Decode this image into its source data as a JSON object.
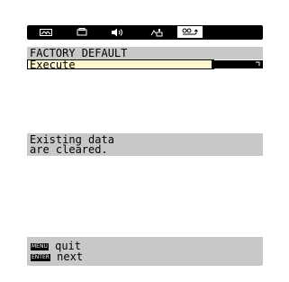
{
  "tabs": [
    {
      "icon": "picture-icon"
    },
    {
      "icon": "display-icon"
    },
    {
      "icon": "audio-icon"
    },
    {
      "icon": "settings-icon"
    },
    {
      "icon": "setup-icon",
      "active": true
    }
  ],
  "menu": {
    "title": "FACTORY DEFAULT",
    "item_label": "Execute"
  },
  "message": {
    "line1": "Existing data",
    "line2": "are cleared."
  },
  "footer": {
    "menu_key": "MENU",
    "menu_action": "quit",
    "enter_key": "ENTER",
    "enter_action": "next"
  },
  "colors": {
    "band": "#c8c8c8",
    "highlight": "#fff7cc"
  }
}
